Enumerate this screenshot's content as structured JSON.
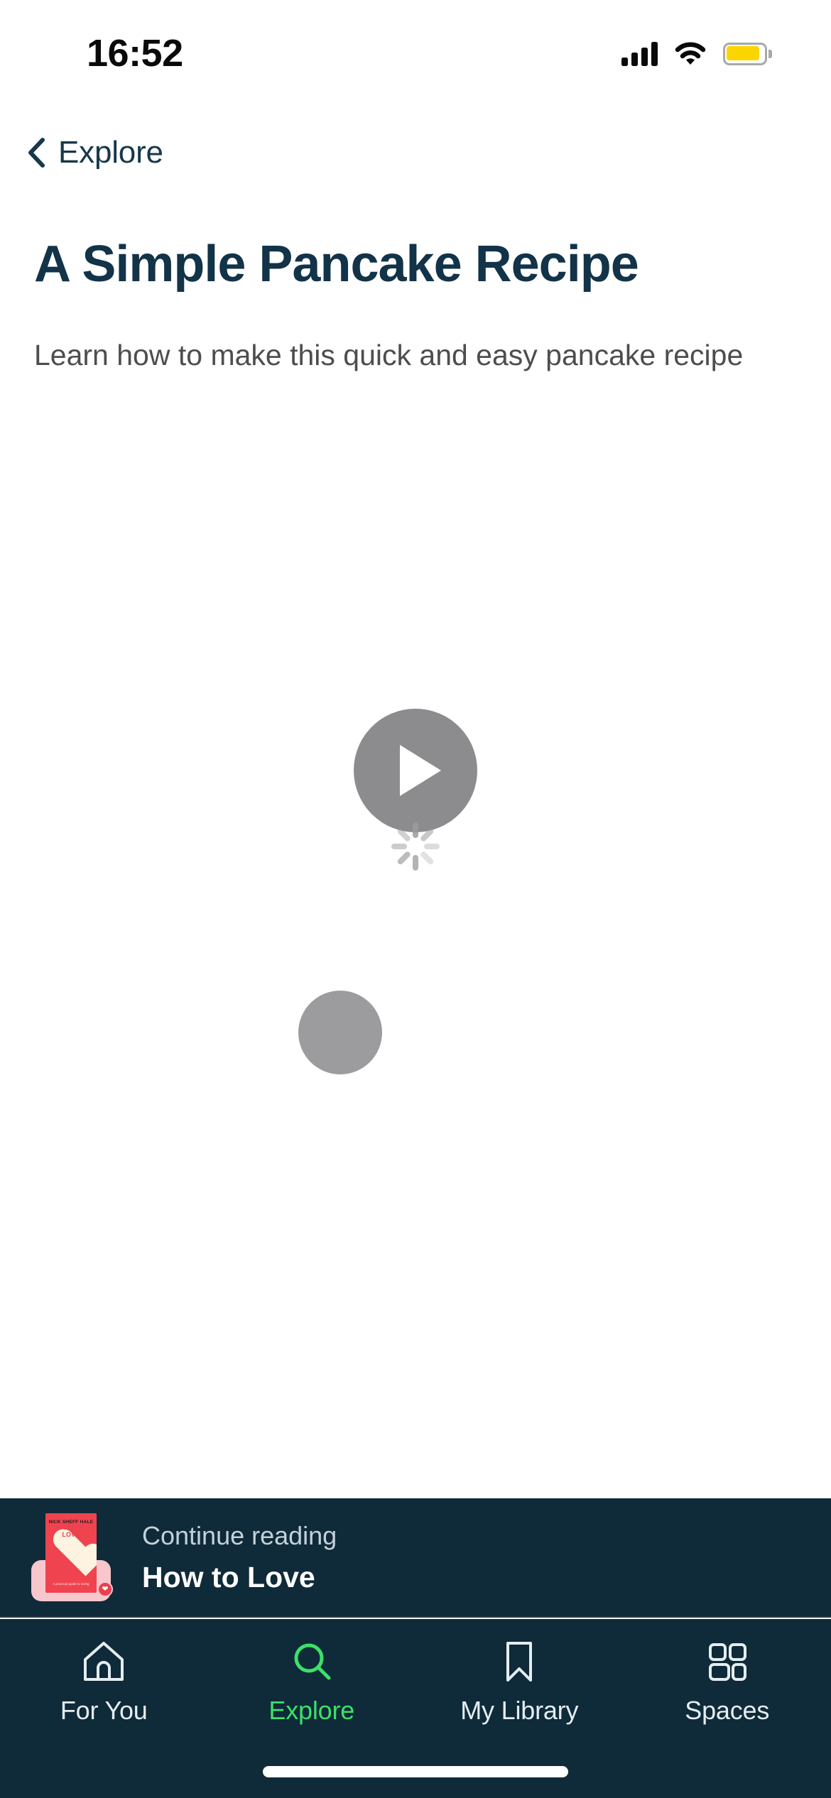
{
  "status_bar": {
    "time": "16:52",
    "signal_icon": "cellular-signal-icon",
    "wifi_icon": "wifi-icon",
    "battery_icon": "battery-icon",
    "battery_color": "#fcd500"
  },
  "nav": {
    "back_icon": "chevron-left-icon",
    "back_label": "Explore"
  },
  "article": {
    "title": "A Simple Pancake Recipe",
    "subtitle": "Learn how to make this quick and easy pancake recipe"
  },
  "media": {
    "play_icon": "play-icon",
    "spinner_icon": "loading-spinner-icon",
    "placeholder_icon": "image-placeholder-circle",
    "placeholder_color": "#8c8c8e"
  },
  "continue_reading": {
    "label": "Continue reading",
    "title": "How to Love",
    "cover": {
      "author": "NICK SHEFF HALE",
      "heading": "HOW TO LOVE",
      "subtitle": "A practical guide to loving",
      "badge_icon": "heart-badge-icon",
      "cover_color": "#ef4450",
      "accent_color": "#f8c6cd"
    }
  },
  "tab_bar": {
    "active_color": "#3ce06a",
    "inactive_color": "#e4edf1",
    "items": [
      {
        "label": "For You",
        "icon": "home-icon",
        "active": false
      },
      {
        "label": "Explore",
        "icon": "search-icon",
        "active": true
      },
      {
        "label": "My Library",
        "icon": "bookmark-icon",
        "active": false
      },
      {
        "label": "Spaces",
        "icon": "grid-icon",
        "active": false
      }
    ]
  },
  "home_indicator": {
    "icon": "home-indicator-bar"
  }
}
